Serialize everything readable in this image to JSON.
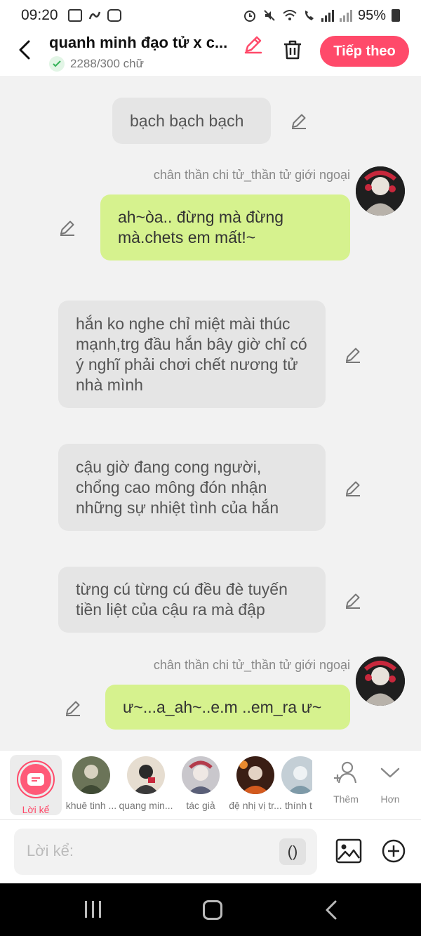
{
  "status_bar": {
    "time": "09:20",
    "battery": "95%",
    "left_icons": [
      "image-icon",
      "app-icon",
      "video-icon"
    ],
    "right_icons": [
      "alarm-icon",
      "mute-icon",
      "wifi-icon",
      "call-icon",
      "signal-icon",
      "battery-icon"
    ]
  },
  "header": {
    "title": "quanh minh đạo tử x c...",
    "word_count": "2288/300 chữ",
    "next_button": "Tiếp theo"
  },
  "colors": {
    "accent": "#ff4a6a",
    "green_bubble": "#d6f28e",
    "grey_bubble": "#e5e5e5"
  },
  "messages": [
    {
      "type": "narration",
      "text": "bạch bạch bạch"
    },
    {
      "type": "character",
      "sender": "chân thần chi tử_thần tử giới ngoại",
      "text": "ah~òa.. đừng mà đừng mà.chets em mất!~"
    },
    {
      "type": "narration",
      "text": "hắn ko nghe chỉ miệt mài thúc mạnh,trg đầu hắn bây giờ chỉ có ý nghĩ phải chơi chết nương tử nhà mình"
    },
    {
      "type": "narration",
      "text": "cậu giờ đang cong người, chổng cao mông đón nhận những sự nhiệt tình của hắn"
    },
    {
      "type": "narration",
      "text": "từng cú từng cú đều đè tuyến tiền liệt  của cậu ra mà đập"
    },
    {
      "type": "character",
      "sender": "chân thần chi tử_thần tử giới ngoại",
      "text": "ư~...a_ah~..e.m ..em_ra ư~"
    }
  ],
  "character_bar": {
    "narration_label": "Lời kể",
    "characters": [
      "khuê tinh ...",
      "quang min...",
      "tác giả",
      "đệ nhị vị tr...",
      "thính t"
    ],
    "more_label": "Thêm",
    "expand_label": "Hơn"
  },
  "input": {
    "placeholder": "Lời kể:",
    "paren_button": "()"
  }
}
